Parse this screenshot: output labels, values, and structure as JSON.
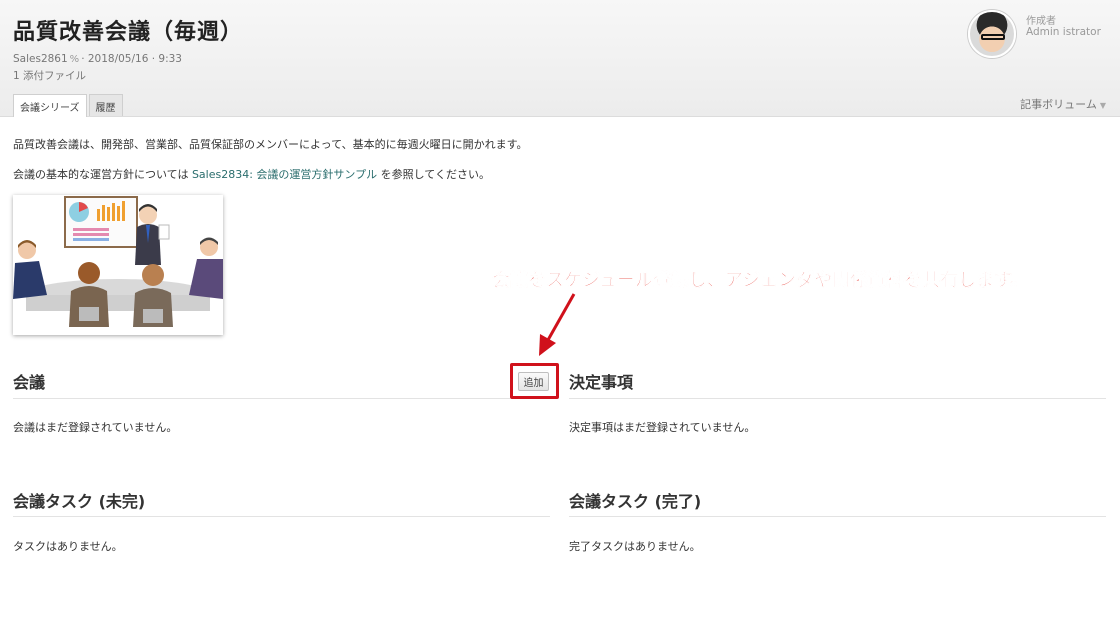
{
  "header": {
    "title": "品質改善会議（毎週）",
    "meta_id": "Sales2861",
    "meta_link_icon": "link-icon",
    "meta_date": "· 2018/05/16 · 9:33",
    "attachments": "1 添付ファイル",
    "tabs": [
      {
        "label": "会議シリーズ",
        "active": true
      },
      {
        "label": "履歴",
        "active": false
      }
    ],
    "volume_label": "記事ボリューム",
    "author_label": "作成者",
    "author_name": "Admin istrator"
  },
  "content": {
    "paragraph1": "品質改善会議は、開発部、営業部、品質保証部のメンバーによって、基本的に毎週火曜日に開かれます。",
    "paragraph2_prefix": "会議の基本的な運営方針については",
    "paragraph2_link": "Sales2834: 会議の運営方針サンプル",
    "paragraph2_suffix": "を参照してください。"
  },
  "annotation": {
    "callout_text": "会議をスケジュール登録し、アジェンダや関係資料を共有します。",
    "color": "#e2231a"
  },
  "sections": {
    "meetings": {
      "title": "会議",
      "add_label": "追加",
      "empty": "会議はまだ登録されていません。"
    },
    "decisions": {
      "title": "決定事項",
      "empty": "決定事項はまだ登録されていません。"
    },
    "tasks_open": {
      "title": "会議タスク (未完)",
      "empty": "タスクはありません。"
    },
    "tasks_done": {
      "title": "会議タスク (完了)",
      "empty": "完了タスクはありません。"
    }
  },
  "colors": {
    "link": "#2a6d6d",
    "accent_red": "#d0111b"
  }
}
